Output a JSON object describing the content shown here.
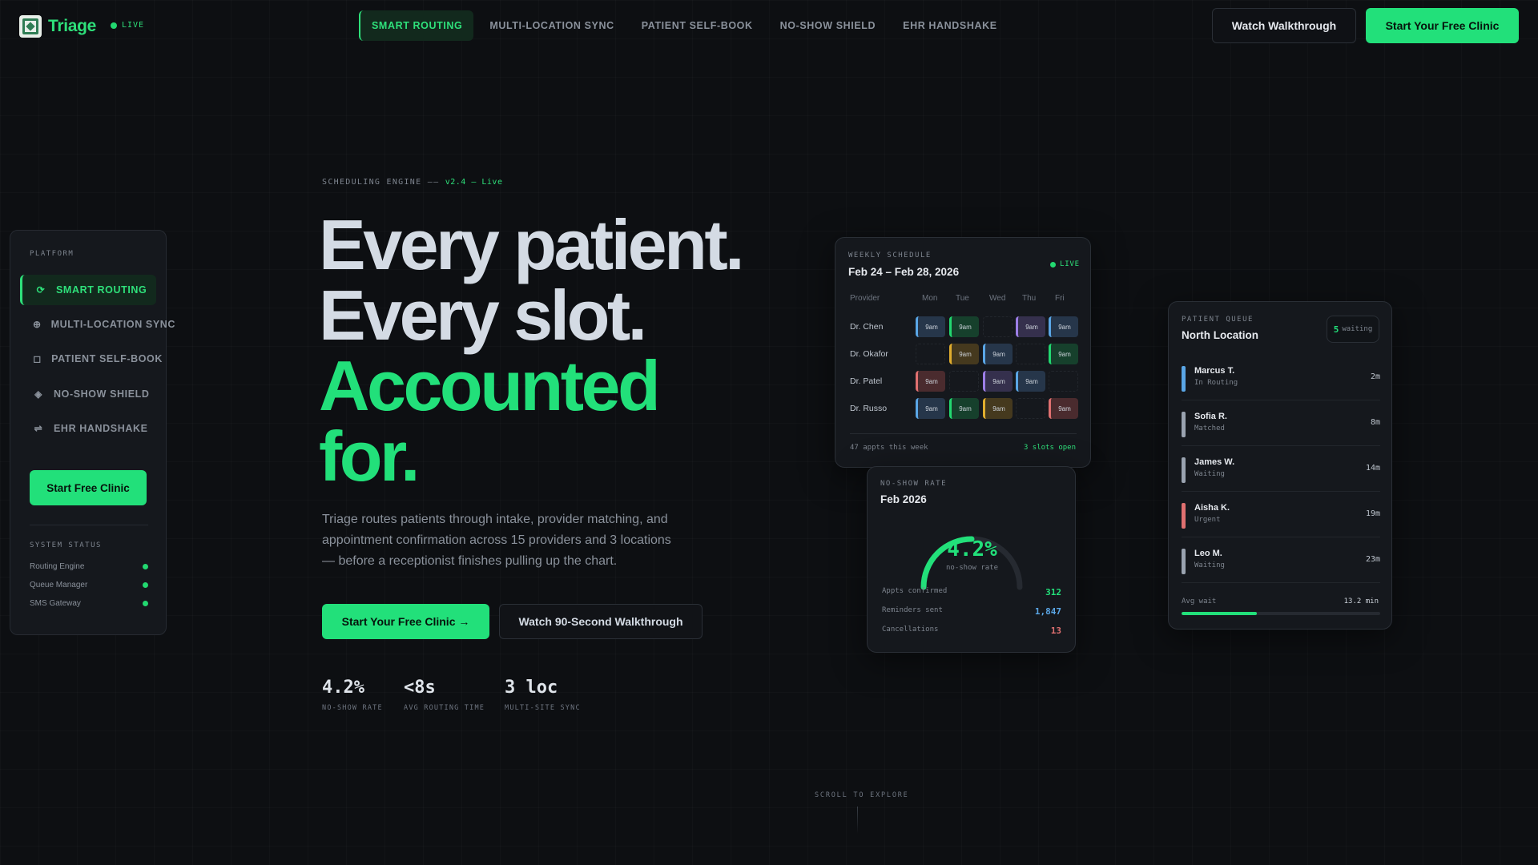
{
  "brand": {
    "name": "Triage",
    "live_label": "LIVE"
  },
  "nav": {
    "tabs": [
      "SMART ROUTING",
      "MULTI-LOCATION SYNC",
      "PATIENT SELF-BOOK",
      "NO-SHOW SHIELD",
      "EHR HANDSHAKE"
    ],
    "active_tab": "SMART ROUTING",
    "walkthrough_label": "Watch Walkthrough",
    "cta_label": "Start Your Free Clinic"
  },
  "sidebar": {
    "caption": "PLATFORM",
    "items": [
      {
        "label": "SMART ROUTING",
        "icon": "routing-icon",
        "active": true
      },
      {
        "label": "MULTI-LOCATION SYNC",
        "icon": "globe-icon",
        "active": false
      },
      {
        "label": "PATIENT SELF-BOOK",
        "icon": "square-icon",
        "active": false
      },
      {
        "label": "NO-SHOW SHIELD",
        "icon": "diamond-icon",
        "active": false
      },
      {
        "label": "EHR HANDSHAKE",
        "icon": "exchange-icon",
        "active": false
      }
    ],
    "cta_label": "Start Free Clinic",
    "status_caption": "SYSTEM STATUS",
    "status": [
      {
        "label": "Routing Engine",
        "state": "online"
      },
      {
        "label": "Queue Manager",
        "state": "online"
      },
      {
        "label": "SMS Gateway",
        "state": "online"
      }
    ]
  },
  "hero": {
    "eyebrow": "SCHEDULING ENGINE ——",
    "version": "v2.4 — Live",
    "lines": [
      "Every patient.",
      "Every slot.",
      "Accounted",
      "for."
    ],
    "subtitle": "Triage routes patients through intake, provider matching, and appointment confirmation across 15 providers and 3 locations — before a receptionist finishes pulling up the chart.",
    "cta_primary": "Start Your Free Clinic →",
    "cta_secondary": "Watch 90-Second Walkthrough",
    "stats": [
      {
        "value": "4.2%",
        "label": "NO-SHOW RATE"
      },
      {
        "value": "<8s",
        "label": "AVG ROUTING TIME"
      },
      {
        "value": "3 loc",
        "label": "MULTI-SITE SYNC"
      }
    ]
  },
  "schedule": {
    "caption": "WEEKLY SCHEDULE",
    "title": "Feb 24 – Feb 28, 2026",
    "live_label": "LIVE",
    "provider_header": "Provider",
    "days": [
      "Mon",
      "Tue",
      "Wed",
      "Thu",
      "Fri"
    ],
    "rows": [
      {
        "provider": "Dr. Chen",
        "slots": [
          {
            "t": "9am",
            "c": "blue"
          },
          {
            "t": "9am",
            "c": "green"
          },
          null,
          {
            "t": "9am",
            "c": "purple"
          },
          {
            "t": "9am",
            "c": "blue"
          }
        ]
      },
      {
        "provider": "Dr. Okafor",
        "slots": [
          null,
          {
            "t": "9am",
            "c": "amber"
          },
          {
            "t": "9am",
            "c": "blue"
          },
          null,
          {
            "t": "9am",
            "c": "green"
          }
        ]
      },
      {
        "provider": "Dr. Patel",
        "slots": [
          {
            "t": "9am",
            "c": "red"
          },
          null,
          {
            "t": "9am",
            "c": "purple"
          },
          {
            "t": "9am",
            "c": "blue"
          },
          null
        ]
      },
      {
        "provider": "Dr. Russo",
        "slots": [
          {
            "t": "9am",
            "c": "blue"
          },
          {
            "t": "9am",
            "c": "green"
          },
          {
            "t": "9am",
            "c": "amber"
          },
          null,
          {
            "t": "9am",
            "c": "red"
          }
        ]
      }
    ],
    "footer_left": "47 appts this week",
    "footer_right": "3 slots open"
  },
  "noshow": {
    "caption": "NO-SHOW RATE",
    "title": "Feb 2026",
    "value": "4.2%",
    "value_label": "no-show rate",
    "rows": [
      {
        "label": "Appts confirmed",
        "value": "312",
        "color": "#22e07a"
      },
      {
        "label": "Reminders sent",
        "value": "1,847",
        "color": "#5aa6e6"
      },
      {
        "label": "Cancellations",
        "value": "13",
        "color": "#e07070"
      }
    ]
  },
  "queue": {
    "caption": "PATIENT QUEUE",
    "title": "North Location",
    "waiting_count": "5",
    "waiting_label": "waiting",
    "patients": [
      {
        "name": "Marcus T.",
        "status": "In Routing",
        "time": "2m",
        "color": "#5aa6e6"
      },
      {
        "name": "Sofia R.",
        "status": "Matched",
        "time": "8m",
        "color": "#9aa3b0"
      },
      {
        "name": "James W.",
        "status": "Waiting",
        "time": "14m",
        "color": "#9aa3b0"
      },
      {
        "name": "Aisha K.",
        "status": "Urgent",
        "time": "19m",
        "color": "#e07070"
      },
      {
        "name": "Leo M.",
        "status": "Waiting",
        "time": "23m",
        "color": "#9aa3b0"
      }
    ],
    "avg_label": "Avg wait",
    "avg_value": "13.2 min",
    "avg_progress": 0.38
  },
  "scroll_label": "SCROLL TO EXPLORE",
  "colors": {
    "accent": "#22e07a",
    "bg": "#0d0f12",
    "card": "#15181d"
  }
}
